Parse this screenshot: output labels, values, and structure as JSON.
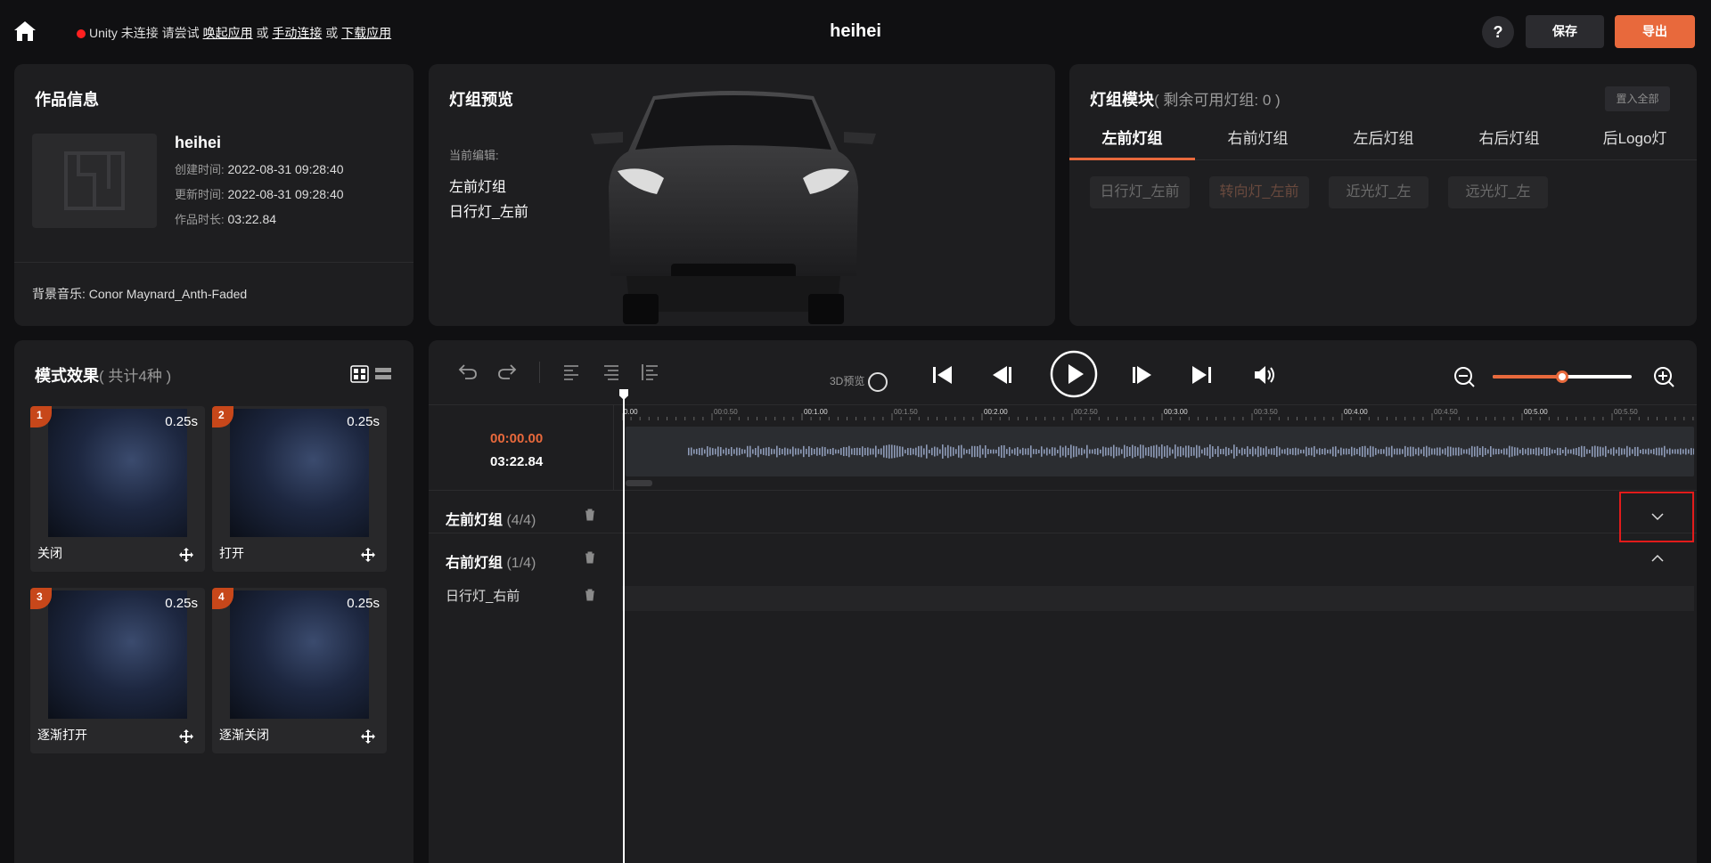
{
  "header": {
    "status_prefix": "Unity 未连接 请尝试",
    "wake_app": "唤起应用",
    "or1": "或",
    "manual_connect": "手动连接",
    "or2": "或",
    "download_app": "下载应用",
    "title": "heihei",
    "help": "?",
    "save": "保存",
    "export": "导出"
  },
  "info": {
    "title": "作品信息",
    "name": "heihei",
    "created_key": "创建时间:",
    "created": "2022-08-31 09:28:40",
    "updated_key": "更新时间:",
    "updated": "2022-08-31 09:28:40",
    "duration_key": "作品时长:",
    "duration": "03:22.84",
    "bgm": "背景音乐: Conor Maynard_Anth-Faded"
  },
  "preview": {
    "title": "灯组预览",
    "current_label": "当前编辑:",
    "group": "左前灯组",
    "light": "日行灯_左前"
  },
  "module": {
    "title": "灯组模块",
    "subtitle": "( 剩余可用灯组: 0 )",
    "put_all": "置入全部",
    "tabs": [
      "左前灯组",
      "右前灯组",
      "左后灯组",
      "右后灯组",
      "后Logo灯"
    ],
    "active_tab": 0,
    "chips": [
      "日行灯_左前",
      "转向灯_左前",
      "近光灯_左",
      "远光灯_左"
    ]
  },
  "effects": {
    "title": "模式效果",
    "subtitle": "( 共计4种 )",
    "cards": [
      {
        "num": "1",
        "duration": "0.25s",
        "name": "关闭"
      },
      {
        "num": "2",
        "duration": "0.25s",
        "name": "打开"
      },
      {
        "num": "3",
        "duration": "0.25s",
        "name": "逐渐打开"
      },
      {
        "num": "4",
        "duration": "0.25s",
        "name": "逐渐关闭"
      }
    ]
  },
  "timeline": {
    "preview3d": "3D预览",
    "zoom_level": 0.5,
    "time_current": "00:00.00",
    "time_total": "03:22.84",
    "ruler_ticks": [
      "0.00",
      "00:0.50",
      "00:1.00",
      "00:1.50",
      "00:2.00",
      "00:2.50",
      "00:3.00",
      "00:3.50",
      "00:4.00",
      "00:4.50",
      "00:5.00",
      "00:5.50",
      "0"
    ],
    "groups": [
      {
        "name": "左前灯组",
        "count": "(4/4)"
      },
      {
        "name": "右前灯组",
        "count": "(1/4)"
      }
    ],
    "track": "日行灯_右前"
  },
  "colors": {
    "accent": "#e8693c",
    "panel": "#1e1e20",
    "background": "#101012",
    "highlight": "#e21b1b"
  },
  "icons": [
    "home-icon",
    "undo-icon",
    "redo-icon",
    "align-left-icon",
    "align-center-icon",
    "align-distribute-icon",
    "skip-start-icon",
    "step-back-icon",
    "play-icon",
    "step-forward-icon",
    "skip-end-icon",
    "volume-icon",
    "zoom-out-icon",
    "zoom-in-icon",
    "trash-icon",
    "chevron-down-icon",
    "chevron-up-icon",
    "move-icon",
    "grid-view-icon",
    "list-view-icon"
  ]
}
